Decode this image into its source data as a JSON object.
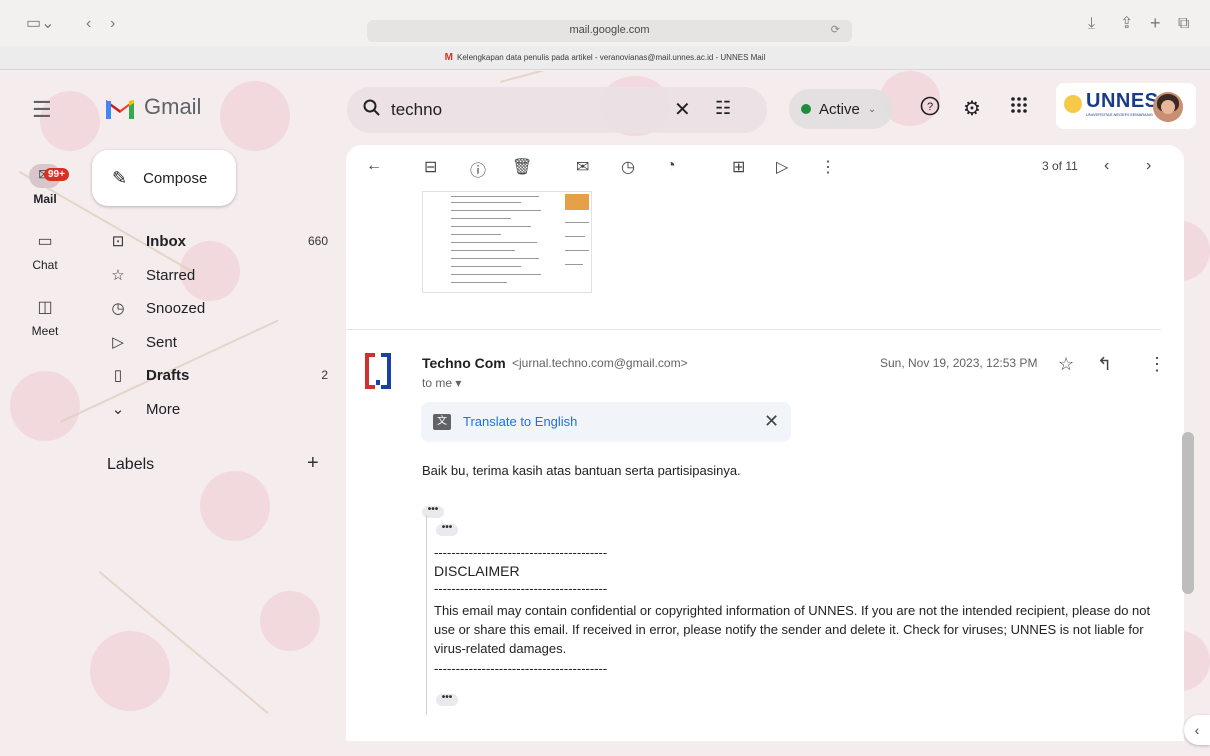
{
  "browser": {
    "url": "mail.google.com",
    "tab_title": "Kelengkapan data penulis pada artikel - veranovianas@mail.unnes.ac.id - UNNES Mail"
  },
  "app": {
    "name": "Gmail",
    "account_badge": "UNNES",
    "account_badge_sub": "UNIVERSITAS NEGERI SEMARANG"
  },
  "search": {
    "value": "techno"
  },
  "status": {
    "label": "Active"
  },
  "rail": {
    "mail_label": "Mail",
    "mail_badge": "99+",
    "chat_label": "Chat",
    "meet_label": "Meet"
  },
  "sidebar": {
    "compose_label": "Compose",
    "items": [
      {
        "label": "Inbox",
        "count": "660",
        "icon": "inbox-icon"
      },
      {
        "label": "Starred",
        "count": "",
        "icon": "star-icon"
      },
      {
        "label": "Snoozed",
        "count": "",
        "icon": "clock-icon"
      },
      {
        "label": "Sent",
        "count": "",
        "icon": "send-icon"
      },
      {
        "label": "Drafts",
        "count": "2",
        "icon": "draft-icon"
      },
      {
        "label": "More",
        "count": "",
        "icon": "chevron-down-icon"
      }
    ],
    "labels_heading": "Labels"
  },
  "toolbar": {
    "pager": "3 of 11"
  },
  "message": {
    "sender_name": "Techno Com",
    "sender_email": "<jurnal.techno.com@gmail.com>",
    "to": "to me",
    "date": "Sun, Nov 19, 2023, 12:53 PM",
    "translate_label": "Translate to English",
    "body": "Baik bu, terima kasih atas bantuan serta partisipasinya.",
    "dashes": "----------------------------------------",
    "disclaimer_title": "DISCLAIMER",
    "disclaimer_text": "This email may contain confidential or copyrighted information of UNNES. If you are not the intended recipient, please do not use or share this email. If received in error, please notify the sender and delete it. Check for viruses; UNNES is not liable for virus-related damages."
  },
  "colors": {
    "accent": "#1a73e8",
    "active_dot": "#1e8e3e",
    "badge_red": "#d93025",
    "unnes_blue": "#1a3b8c"
  }
}
